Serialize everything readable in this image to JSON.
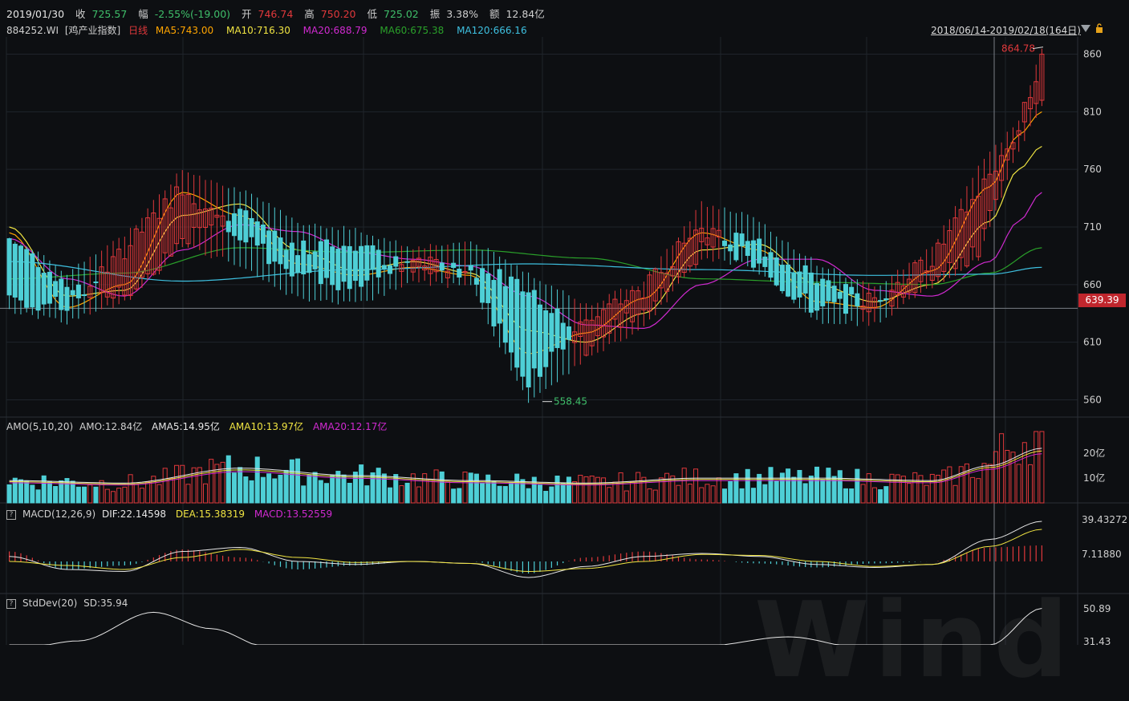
{
  "header": {
    "date": "2019/01/30",
    "close_label": "收",
    "close_value": "725.57",
    "change_label": "幅",
    "change_value": "-2.55%(-19.00)",
    "open_label": "开",
    "open_value": "746.74",
    "high_label": "高",
    "high_value": "750.20",
    "low_label": "低",
    "low_value": "725.02",
    "amplitude_label": "振",
    "amplitude_value": "3.38%",
    "amount_label": "额",
    "amount_value": "12.84亿"
  },
  "ma_row": {
    "code": "884252.WI",
    "index_name": "[鸡产业指数]",
    "period": "日线",
    "ma5": "MA5:743.00",
    "ma10": "MA10:716.30",
    "ma20": "MA20:688.79",
    "ma60": "MA60:675.38",
    "ma120": "MA120:666.16"
  },
  "range_label": "2018/06/14-2019/02/18(164日)",
  "price_tag": "639.39",
  "amo": {
    "title": "AMO(5,10,20)",
    "amo": "AMO:12.84亿",
    "ama5": "AMA5:14.95亿",
    "ama10": "AMA10:13.97亿",
    "ama20": "AMA20:12.17亿"
  },
  "macd": {
    "title": "MACD(12,26,9)",
    "dif": "DIF:22.14598",
    "dea": "DEA:15.38319",
    "macd": "MACD:13.52559"
  },
  "stddev": {
    "title": "StdDev(20)",
    "sd": "SD:35.94"
  },
  "watermark": "Wind",
  "colors": {
    "up": "#e0383b",
    "down": "#4ecfd6",
    "ma5": "#ffa500",
    "ma10": "#f0e442",
    "ma20": "#d02ad0",
    "ma60": "#2aa02a",
    "ma120": "#3ec0e0",
    "bg": "#0d0f12"
  },
  "chart_data": [
    {
      "type": "candlestick",
      "y_axis_ticks": [
        "860",
        "810",
        "760",
        "710",
        "660",
        "610",
        "560"
      ],
      "ylim": [
        545,
        875
      ],
      "annotations": {
        "max": "864.78",
        "min": "558.45"
      },
      "ohlc_anchor_points": [
        [
          0,
          700,
          700,
          640,
          650
        ],
        [
          10,
          660,
          668,
          630,
          640
        ],
        [
          20,
          650,
          700,
          648,
          690
        ],
        [
          30,
          700,
          758,
          695,
          745
        ],
        [
          40,
          725,
          740,
          680,
          700
        ],
        [
          50,
          690,
          712,
          650,
          670
        ],
        [
          60,
          695,
          705,
          645,
          660
        ],
        [
          70,
          670,
          690,
          665,
          680
        ],
        [
          80,
          675,
          695,
          660,
          670
        ],
        [
          90,
          660,
          668,
          560,
          575
        ],
        [
          100,
          605,
          640,
          598,
          630
        ],
        [
          110,
          640,
          660,
          625,
          655
        ],
        [
          120,
          690,
          728,
          685,
          712
        ],
        [
          128,
          700,
          718,
          680,
          682
        ],
        [
          140,
          665,
          676,
          630,
          638
        ],
        [
          150,
          640,
          655,
          628,
          648
        ],
        [
          160,
          665,
          690,
          660,
          682
        ],
        [
          168,
          690,
          760,
          685,
          740
        ],
        [
          175,
          790,
          800,
          780,
          795
        ],
        [
          179,
          820,
          864.78,
          815,
          860
        ]
      ],
      "series": [
        {
          "name": "MA5",
          "anchors": [
            [
              0,
              705
            ],
            [
              10,
              640
            ],
            [
              20,
              660
            ],
            [
              30,
              740
            ],
            [
              40,
              720
            ],
            [
              50,
              678
            ],
            [
              60,
              668
            ],
            [
              70,
              675
            ],
            [
              80,
              668
            ],
            [
              90,
              600
            ],
            [
              100,
              618
            ],
            [
              110,
              648
            ],
            [
              120,
              705
            ],
            [
              130,
              690
            ],
            [
              140,
              645
            ],
            [
              150,
              640
            ],
            [
              160,
              672
            ],
            [
              170,
              745
            ],
            [
              175,
              790
            ],
            [
              179,
              810
            ]
          ]
        },
        {
          "name": "MA10",
          "anchors": [
            [
              0,
              710
            ],
            [
              10,
              650
            ],
            [
              20,
              655
            ],
            [
              30,
              720
            ],
            [
              40,
              730
            ],
            [
              50,
              690
            ],
            [
              60,
              672
            ],
            [
              70,
              680
            ],
            [
              80,
              670
            ],
            [
              90,
              620
            ],
            [
              100,
              610
            ],
            [
              110,
              635
            ],
            [
              120,
              690
            ],
            [
              130,
              695
            ],
            [
              140,
              660
            ],
            [
              150,
              645
            ],
            [
              160,
              660
            ],
            [
              170,
              715
            ],
            [
              175,
              760
            ],
            [
              179,
              780
            ]
          ]
        },
        {
          "name": "MA20",
          "anchors": [
            [
              0,
              700
            ],
            [
              10,
              665
            ],
            [
              20,
              650
            ],
            [
              30,
              690
            ],
            [
              40,
              712
            ],
            [
              50,
              706
            ],
            [
              60,
              688
            ],
            [
              70,
              682
            ],
            [
              80,
              676
            ],
            [
              90,
              650
            ],
            [
              100,
              625
            ],
            [
              110,
              622
            ],
            [
              120,
              660
            ],
            [
              130,
              682
            ],
            [
              140,
              682
            ],
            [
              150,
              655
            ],
            [
              160,
              650
            ],
            [
              170,
              680
            ],
            [
              175,
              715
            ],
            [
              179,
              740
            ]
          ]
        },
        {
          "name": "MA60",
          "anchors": [
            [
              0,
              665
            ],
            [
              20,
              670
            ],
            [
              40,
              692
            ],
            [
              60,
              688
            ],
            [
              80,
              690
            ],
            [
              100,
              683
            ],
            [
              120,
              665
            ],
            [
              140,
              662
            ],
            [
              160,
              660
            ],
            [
              170,
              670
            ],
            [
              179,
              692
            ]
          ]
        },
        {
          "name": "MA120",
          "anchors": [
            [
              0,
              680
            ],
            [
              30,
              663
            ],
            [
              60,
              673
            ],
            [
              90,
              678
            ],
            [
              120,
              673
            ],
            [
              150,
              668
            ],
            [
              170,
              669
            ],
            [
              179,
              675
            ]
          ]
        }
      ]
    },
    {
      "type": "bar",
      "name": "AMO",
      "y_axis_ticks": [
        "20亿",
        "10亿"
      ],
      "ylim": [
        0,
        32
      ],
      "value_anchors": [
        [
          0,
          9
        ],
        [
          20,
          8
        ],
        [
          40,
          14
        ],
        [
          60,
          11
        ],
        [
          80,
          9
        ],
        [
          100,
          8
        ],
        [
          120,
          10
        ],
        [
          140,
          10
        ],
        [
          160,
          9
        ],
        [
          170,
          15
        ],
        [
          179,
          22
        ]
      ]
    },
    {
      "type": "bar",
      "name": "MACD",
      "y_axis_ticks": [
        "39.43272",
        "7.11880"
      ],
      "dif_anchors": [
        [
          0,
          5
        ],
        [
          10,
          -8
        ],
        [
          20,
          -10
        ],
        [
          30,
          10
        ],
        [
          40,
          14
        ],
        [
          50,
          0
        ],
        [
          60,
          -3
        ],
        [
          70,
          0
        ],
        [
          80,
          -2
        ],
        [
          90,
          -16
        ],
        [
          100,
          -5
        ],
        [
          110,
          5
        ],
        [
          120,
          8
        ],
        [
          130,
          5
        ],
        [
          140,
          -3
        ],
        [
          150,
          -6
        ],
        [
          160,
          -3
        ],
        [
          170,
          22
        ],
        [
          179,
          40
        ]
      ],
      "dea_anchors": [
        [
          0,
          0
        ],
        [
          10,
          -4
        ],
        [
          20,
          -8
        ],
        [
          30,
          4
        ],
        [
          40,
          12
        ],
        [
          50,
          4
        ],
        [
          60,
          -1
        ],
        [
          70,
          0
        ],
        [
          80,
          -2
        ],
        [
          90,
          -10
        ],
        [
          100,
          -7
        ],
        [
          110,
          0
        ],
        [
          120,
          7
        ],
        [
          130,
          6
        ],
        [
          140,
          0
        ],
        [
          150,
          -5
        ],
        [
          160,
          -3
        ],
        [
          170,
          15
        ],
        [
          179,
          32
        ]
      ]
    },
    {
      "type": "line",
      "name": "StdDev(20)",
      "y_axis_ticks": [
        "50.89",
        "31.43"
      ],
      "anchors": [
        [
          0,
          20
        ],
        [
          12,
          27
        ],
        [
          25,
          48
        ],
        [
          35,
          36
        ],
        [
          45,
          22
        ],
        [
          60,
          20
        ],
        [
          80,
          22
        ],
        [
          100,
          22
        ],
        [
          120,
          23
        ],
        [
          135,
          30
        ],
        [
          150,
          20
        ],
        [
          165,
          22
        ],
        [
          170,
          24
        ],
        [
          179,
          50.89
        ]
      ]
    }
  ]
}
